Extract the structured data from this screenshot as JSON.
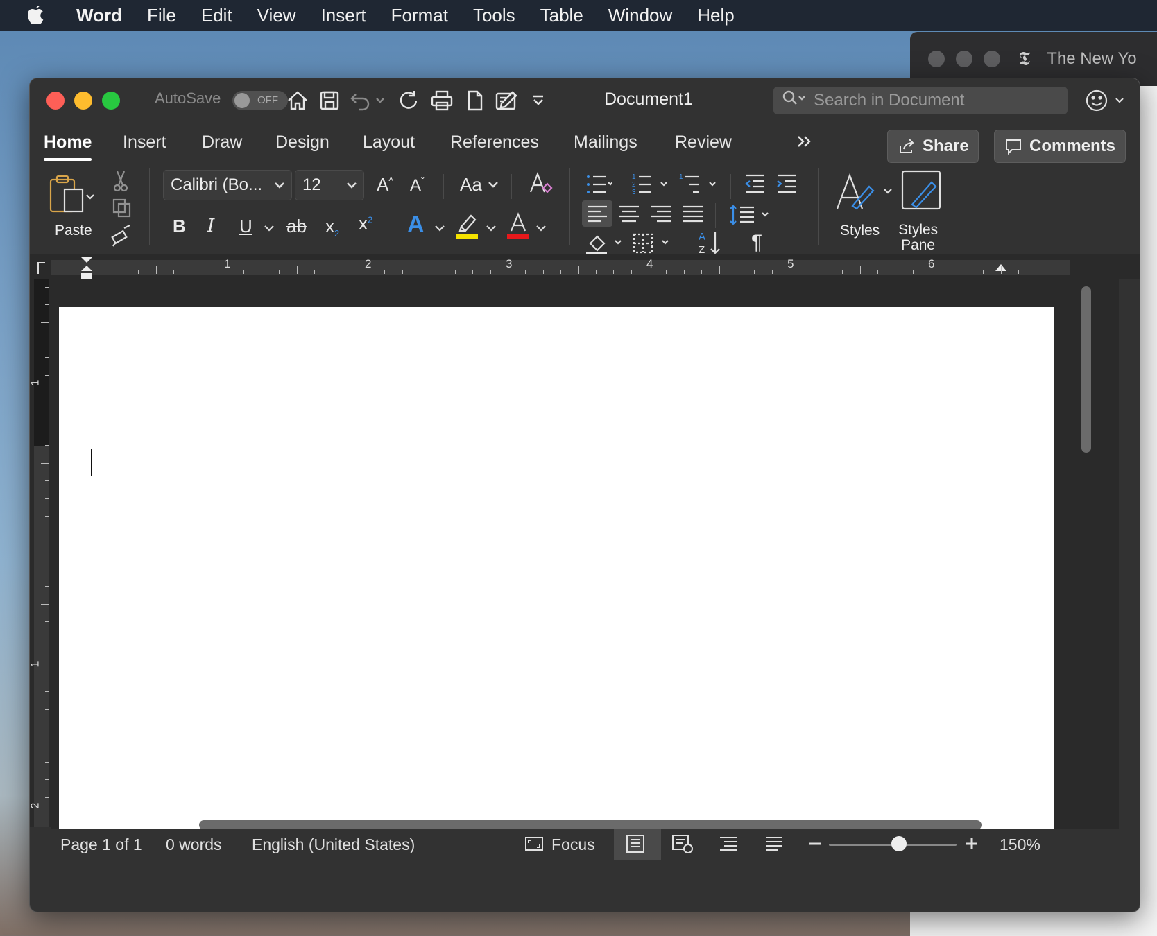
{
  "menubar": {
    "app": "Word",
    "items": [
      "File",
      "Edit",
      "View",
      "Insert",
      "Format",
      "Tools",
      "Table",
      "Window",
      "Help"
    ]
  },
  "background_window": {
    "title": "The New Yo"
  },
  "titlebar": {
    "autosave_label": "AutoSave",
    "autosave_state": "OFF",
    "document_title": "Document1",
    "search_placeholder": "Search in Document"
  },
  "tabs": [
    "Home",
    "Insert",
    "Draw",
    "Design",
    "Layout",
    "References",
    "Mailings",
    "Review"
  ],
  "active_tab": "Home",
  "share_label": "Share",
  "comments_label": "Comments",
  "ribbon": {
    "paste_label": "Paste",
    "font_name": "Calibri (Bo...",
    "font_size": "12",
    "change_case_label": "Aa",
    "styles_label": "Styles",
    "styles_pane_label_1": "Styles",
    "styles_pane_label_2": "Pane",
    "highlight_color": "#f5e300",
    "font_color": "#e8181b",
    "text_effects_color": "#3b8fe8"
  },
  "ruler": {
    "h_numbers": [
      "1",
      "2",
      "3",
      "4",
      "5",
      "6"
    ],
    "v_numbers": [
      "1",
      "1",
      "2"
    ]
  },
  "statusbar": {
    "page": "Page 1 of 1",
    "words": "0 words",
    "language": "English (United States)",
    "focus": "Focus",
    "zoom": "150%"
  }
}
